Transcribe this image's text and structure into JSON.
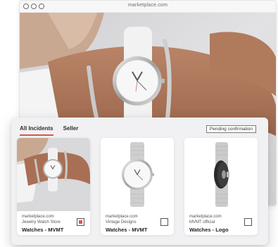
{
  "browser": {
    "url": "marketplace.com"
  },
  "panel": {
    "tabs": [
      {
        "label": "All Incidents",
        "active": true
      },
      {
        "label": "Seller",
        "active": false
      }
    ],
    "pending_label": "Pending confirmation",
    "accent_color": "#d9534f",
    "cards": [
      {
        "domain": "marketplace.com",
        "seller": "Jewelry Watch Store",
        "title": "Watches - MVMT",
        "checked": true
      },
      {
        "domain": "marketplace.com",
        "seller": "Vintage Designs",
        "title": "Watches - MVMT",
        "checked": false
      },
      {
        "domain": "marketplace.com",
        "seller": "MVMT official",
        "title": "Watches - Logo",
        "checked": false
      }
    ]
  }
}
